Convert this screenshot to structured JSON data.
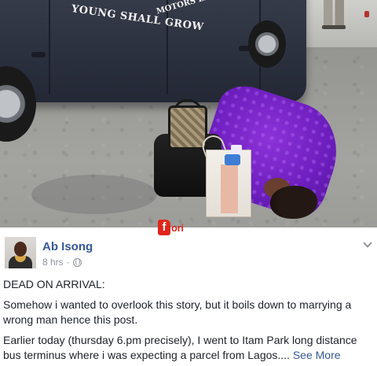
{
  "photo": {
    "van_lettering_line1": "YOUNG SHALL GROW",
    "van_lettering_line2": "MOTORS LIMITED",
    "watermark_f": "f",
    "watermark_rest": "ori"
  },
  "post": {
    "author": "Ab Isong",
    "time": "8 hrs",
    "separator": "·",
    "paragraphs": [
      "DEAD ON ARRIVAL:",
      "Somehow i wanted to overlook this story, but it boils down to marrying a wrong man hence this post.",
      "Earlier today (thursday 6.pm precisely), I went to Itam Park long distance bus terminus where i was expecting a parcel from Lagos...."
    ],
    "see_more": "See More"
  },
  "icons": {
    "privacy": "globe-icon",
    "options": "chevron-down-icon"
  },
  "colors": {
    "link": "#365899",
    "meta": "#90949c",
    "text": "#1d2129"
  }
}
